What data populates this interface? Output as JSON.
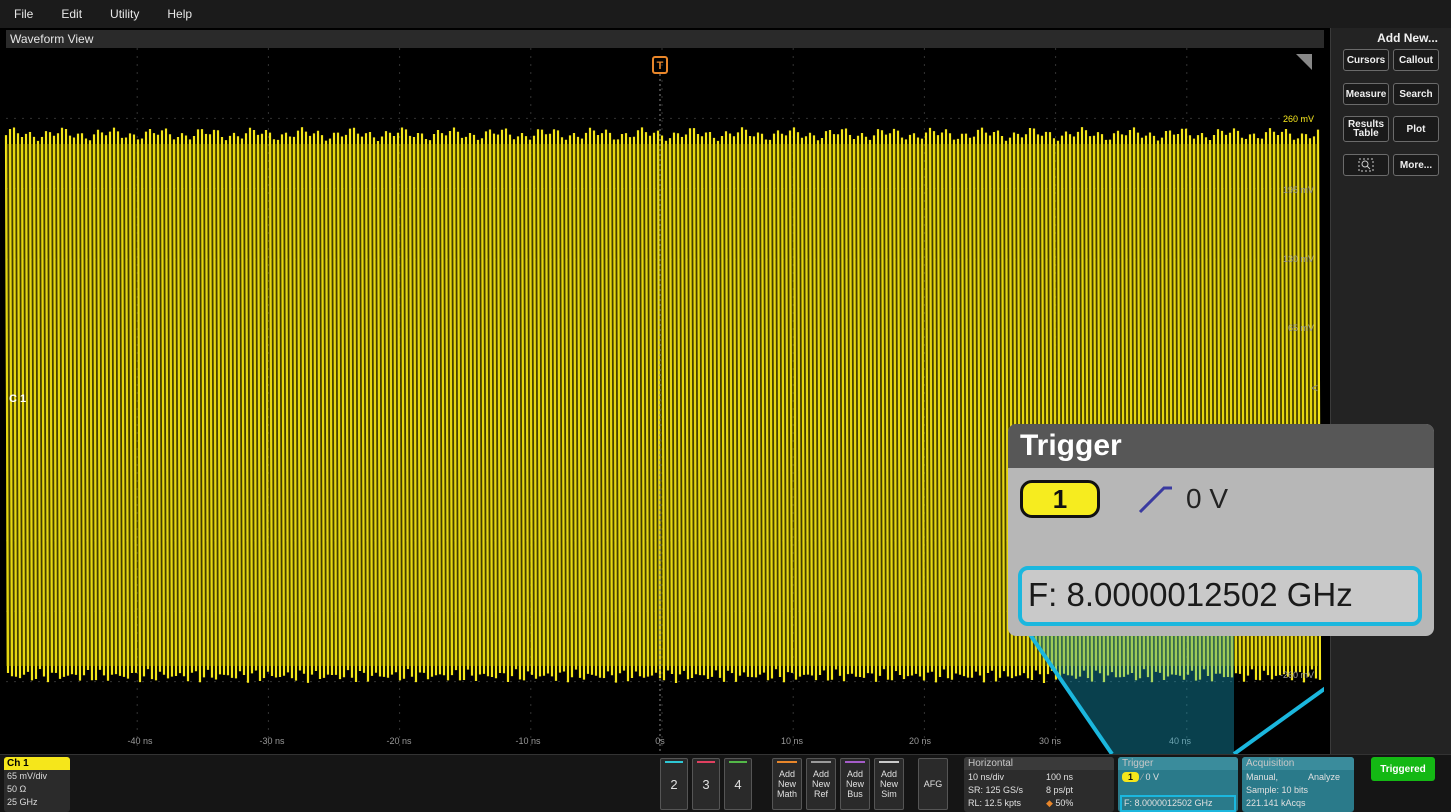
{
  "menu": [
    "File",
    "Edit",
    "Utility",
    "Help"
  ],
  "waveform_view": {
    "title": "Waveform View",
    "channel_label": "C 1",
    "trigger_marker": "T",
    "x_ticks": [
      "-40 ns",
      "-30 ns",
      "-20 ns",
      "-10 ns",
      "0s",
      "10 ns",
      "20 ns",
      "30 ns",
      "40 ns"
    ],
    "y_ticks": [
      "260 mV",
      "195 mV",
      "130 mV",
      "65 mV",
      "-260 mV"
    ]
  },
  "right_panel": {
    "title": "Add New...",
    "buttons": [
      "Cursors",
      "Callout",
      "Measure",
      "Search",
      "Results Table",
      "Plot",
      "More..."
    ]
  },
  "ch1": {
    "label": "Ch 1",
    "scale": "65 mV/div",
    "impedance": "50 Ω",
    "bandwidth": "25 GHz",
    "color": "#f5e61b"
  },
  "channel_buttons": [
    {
      "label": "2",
      "color": "#2ec7d4"
    },
    {
      "label": "3",
      "color": "#e04060"
    },
    {
      "label": "4",
      "color": "#53b848"
    }
  ],
  "add_buttons": [
    {
      "label": "Add New Math",
      "color": "#e8862a"
    },
    {
      "label": "Add New Ref",
      "color": "#9a9a9a"
    },
    {
      "label": "Add New Bus",
      "color": "#a45cc8"
    },
    {
      "label": "Add New Sim",
      "color": "#c9c9c9"
    }
  ],
  "afg_label": "AFG",
  "horizontal": {
    "title": "Horizontal",
    "scale": "10 ns/div",
    "position": "100 ns",
    "sample_rate": "SR: 125 GS/s",
    "resolution": "8 ps/pt",
    "record_length": "RL: 12.5 kpts",
    "position_pct": "50%"
  },
  "trigger": {
    "title": "Trigger",
    "source": "1",
    "level": "0 V",
    "frequency": "F: 8.0000012502 GHz"
  },
  "acquisition": {
    "title": "Acquisition",
    "mode": "Manual,",
    "analyze": "Analyze",
    "sample": "Sample: 10 bits",
    "count": "221.141 kAcqs"
  },
  "zoom": {
    "title": "Trigger",
    "source": "1",
    "level": "0 V",
    "frequency": "F: 8.0000012502 GHz",
    "highlight_color": "#1bb7de"
  },
  "triggered_label": "Triggered"
}
